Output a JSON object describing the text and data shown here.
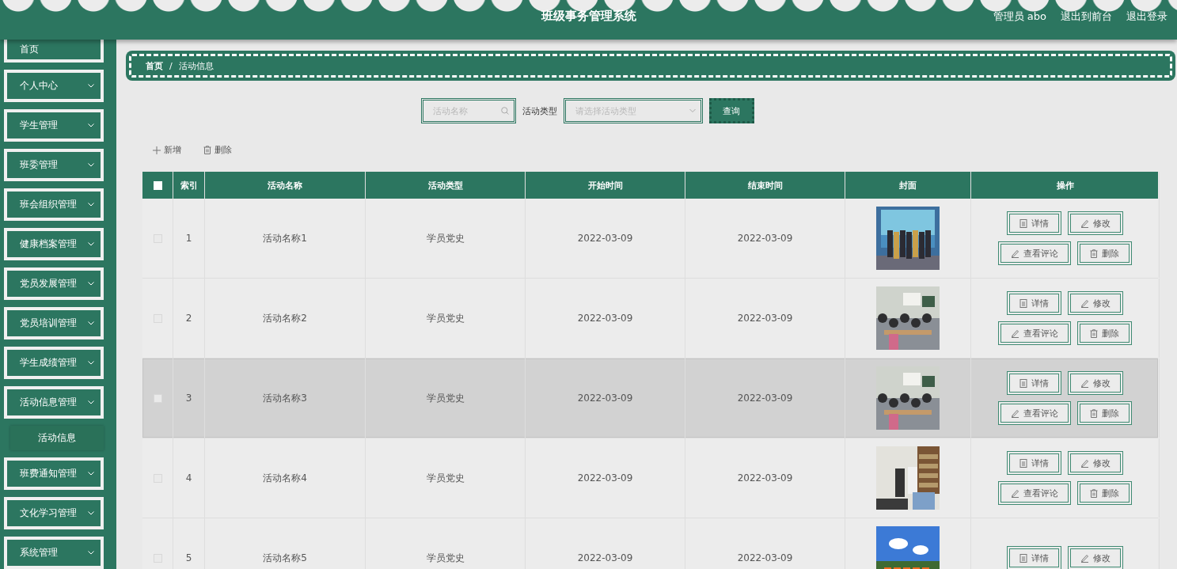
{
  "header": {
    "title": "班级事务管理系统",
    "user": "管理员 abo",
    "links": [
      "退出到前台",
      "退出登录"
    ]
  },
  "sidebar": {
    "items": [
      {
        "label": "首页",
        "kind": "link"
      },
      {
        "label": "个人中心",
        "kind": "menu",
        "expanded": false
      },
      {
        "label": "学生管理",
        "kind": "menu",
        "expanded": false
      },
      {
        "label": "班委管理",
        "kind": "menu",
        "expanded": false
      },
      {
        "label": "班会组织管理",
        "kind": "menu",
        "expanded": false
      },
      {
        "label": "健康档案管理",
        "kind": "menu",
        "expanded": false
      },
      {
        "label": "党员发展管理",
        "kind": "menu",
        "expanded": false
      },
      {
        "label": "党员培训管理",
        "kind": "menu",
        "expanded": false
      },
      {
        "label": "学生成绩管理",
        "kind": "menu",
        "expanded": false
      },
      {
        "label": "活动信息管理",
        "kind": "menu",
        "expanded": true,
        "children": [
          {
            "label": "活动信息",
            "selected": true
          }
        ]
      },
      {
        "label": "班费通知管理",
        "kind": "menu",
        "expanded": false
      },
      {
        "label": "文化学习管理",
        "kind": "menu",
        "expanded": false
      },
      {
        "label": "系统管理",
        "kind": "menu",
        "expanded": false
      }
    ]
  },
  "breadcrumb": {
    "items": [
      "首页",
      "活动信息"
    ],
    "separator": "/"
  },
  "search": {
    "name_placeholder": "活动名称",
    "type_label": "活动类型",
    "type_placeholder": "请选择活动类型",
    "button": "查询"
  },
  "toolbar": [
    {
      "label": "新增",
      "kind": "add"
    },
    {
      "label": "删除",
      "kind": "delete"
    }
  ],
  "table": {
    "select_all": {
      "checked": false
    },
    "columns": [
      "索引",
      "活动名称",
      "活动类型",
      "开始时间",
      "结束时间",
      "封面",
      "操作"
    ],
    "rows": [
      {
        "index": "1",
        "name": "活动名称1",
        "type": "学员党史",
        "start": "2022-03-09",
        "end": "2022-03-09",
        "cover": {
          "kind": "picture"
        },
        "checked": false,
        "highlighted": false,
        "actions": [
          {
            "label": "详情",
            "kind": "detail"
          },
          {
            "label": "修改",
            "kind": "edit"
          },
          {
            "label": "查看评论",
            "kind": "edit"
          },
          {
            "label": "删除",
            "kind": "delete"
          }
        ]
      },
      {
        "index": "2",
        "name": "活动名称2",
        "type": "学员党史",
        "start": "2022-03-09",
        "end": "2022-03-09",
        "cover": {
          "kind": "picture"
        },
        "checked": false,
        "highlighted": false,
        "actions": [
          {
            "label": "详情",
            "kind": "detail"
          },
          {
            "label": "修改",
            "kind": "edit"
          },
          {
            "label": "查看评论",
            "kind": "edit"
          },
          {
            "label": "删除",
            "kind": "delete"
          }
        ]
      },
      {
        "index": "3",
        "name": "活动名称3",
        "type": "学员党史",
        "start": "2022-03-09",
        "end": "2022-03-09",
        "cover": {
          "kind": "picture"
        },
        "checked": false,
        "highlighted": true,
        "actions": [
          {
            "label": "详情",
            "kind": "detail"
          },
          {
            "label": "修改",
            "kind": "edit"
          },
          {
            "label": "查看评论",
            "kind": "edit"
          },
          {
            "label": "删除",
            "kind": "delete"
          }
        ]
      },
      {
        "index": "4",
        "name": "活动名称4",
        "type": "学员党史",
        "start": "2022-03-09",
        "end": "2022-03-09",
        "cover": {
          "kind": "picture"
        },
        "checked": false,
        "highlighted": false,
        "actions": [
          {
            "label": "详情",
            "kind": "detail"
          },
          {
            "label": "修改",
            "kind": "edit"
          },
          {
            "label": "查看评论",
            "kind": "edit"
          },
          {
            "label": "删除",
            "kind": "delete"
          }
        ]
      },
      {
        "index": "5",
        "name": "活动名称5",
        "type": "学员党史",
        "start": "2022-03-09",
        "end": "2022-03-09",
        "cover": {
          "kind": "picture"
        },
        "checked": false,
        "highlighted": false,
        "actions": [
          {
            "label": "详情",
            "kind": "detail"
          },
          {
            "label": "修改",
            "kind": "edit"
          }
        ]
      }
    ]
  }
}
